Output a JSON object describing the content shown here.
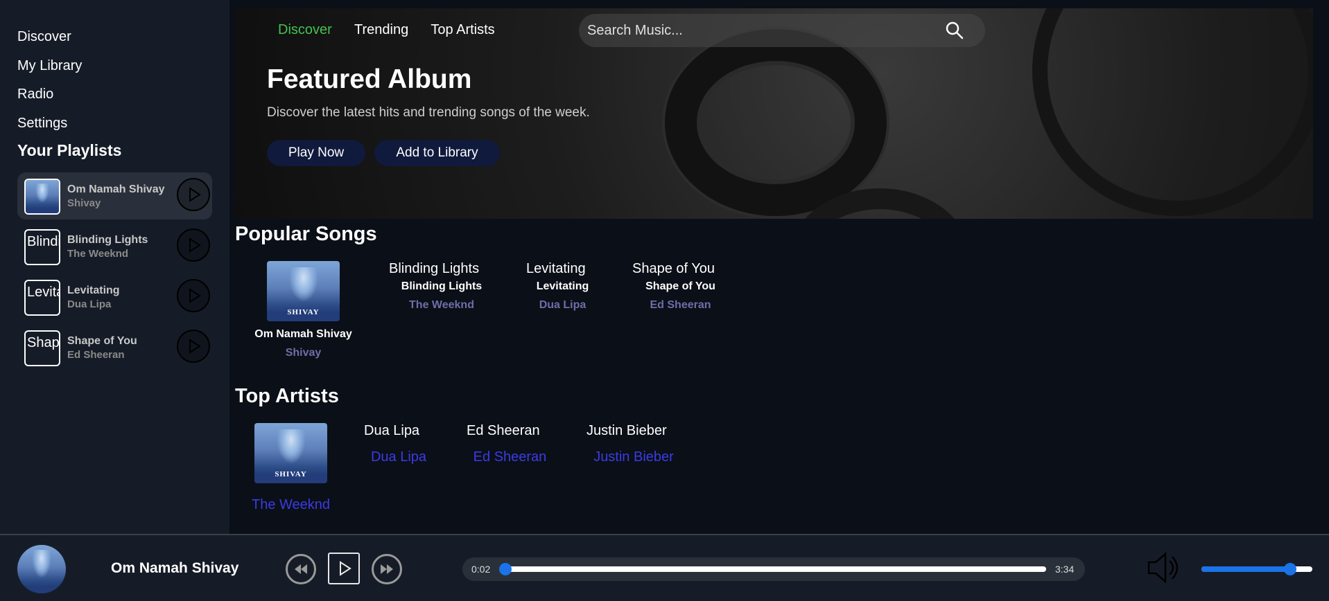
{
  "nav": {
    "items": [
      {
        "label": "Discover"
      },
      {
        "label": "My Library"
      },
      {
        "label": "Radio"
      },
      {
        "label": "Settings"
      }
    ],
    "playlists_title": "Your Playlists"
  },
  "playlists": [
    {
      "title": "Om Namah Shivay",
      "artist": "Shivay",
      "thumb_alt": "",
      "active": true
    },
    {
      "title": "Blinding Lights",
      "artist": "The Weeknd",
      "thumb_alt": "Blinding Lights"
    },
    {
      "title": "Levitating",
      "artist": "Dua Lipa",
      "thumb_alt": "Levitating"
    },
    {
      "title": "Shape of You",
      "artist": "Ed Sheeran",
      "thumb_alt": "Shape of You"
    }
  ],
  "hero": {
    "tabs": [
      {
        "label": "Discover",
        "active": true
      },
      {
        "label": "Trending"
      },
      {
        "label": "Top Artists"
      }
    ],
    "search_placeholder": "Search Music...",
    "title": "Featured Album",
    "subtitle": "Discover the latest hits and trending songs of the week.",
    "play_label": "Play Now",
    "add_label": "Add to Library"
  },
  "popular": {
    "title": "Popular Songs",
    "songs": [
      {
        "title": "Om Namah Shivay",
        "artist": "Shivay",
        "img_alt": "",
        "art_text": "SHIVAY"
      },
      {
        "title": "Blinding Lights",
        "artist": "The Weeknd",
        "img_alt": "Blinding Lights"
      },
      {
        "title": "Levitating",
        "artist": "Dua Lipa",
        "img_alt": "Levitating"
      },
      {
        "title": "Shape of You",
        "artist": "Ed Sheeran",
        "img_alt": "Shape of You"
      }
    ]
  },
  "artists": {
    "title": "Top Artists",
    "items": [
      {
        "name": "The Weeknd",
        "img_alt": "",
        "art_text": "SHIVAY"
      },
      {
        "name": "Dua Lipa",
        "img_alt": "Dua Lipa"
      },
      {
        "name": "Ed Sheeran",
        "img_alt": "Ed Sheeran"
      },
      {
        "name": "Justin Bieber",
        "img_alt": "Justin Bieber"
      }
    ]
  },
  "player": {
    "title": "Om Namah Shivay",
    "current_time": "0:02",
    "duration": "3:34",
    "progress": 0.01,
    "volume": 0.8
  },
  "colors": {
    "accent": "#44c24f",
    "link": "#3b3be6",
    "progress": "#1a73e8"
  }
}
